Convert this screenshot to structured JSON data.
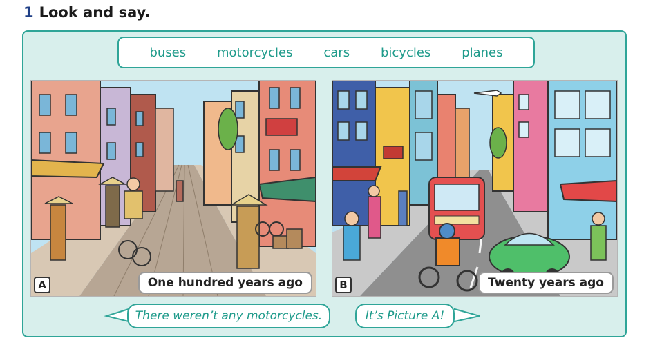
{
  "header": {
    "number": "1",
    "title": "Look and say."
  },
  "words": [
    "buses",
    "motorcycles",
    "cars",
    "bicycles",
    "planes"
  ],
  "pictures": {
    "a": {
      "letter": "A",
      "caption": "One hundred years ago"
    },
    "b": {
      "letter": "B",
      "caption": "Twenty years ago"
    }
  },
  "bubbles": {
    "left": "There weren’t any motorcycles.",
    "right": "It’s Picture A!"
  },
  "colors": {
    "accent": "#2fa598",
    "panel_bg": "#d8efec",
    "word_text": "#1f9b8b",
    "number": "#1f3f86"
  }
}
